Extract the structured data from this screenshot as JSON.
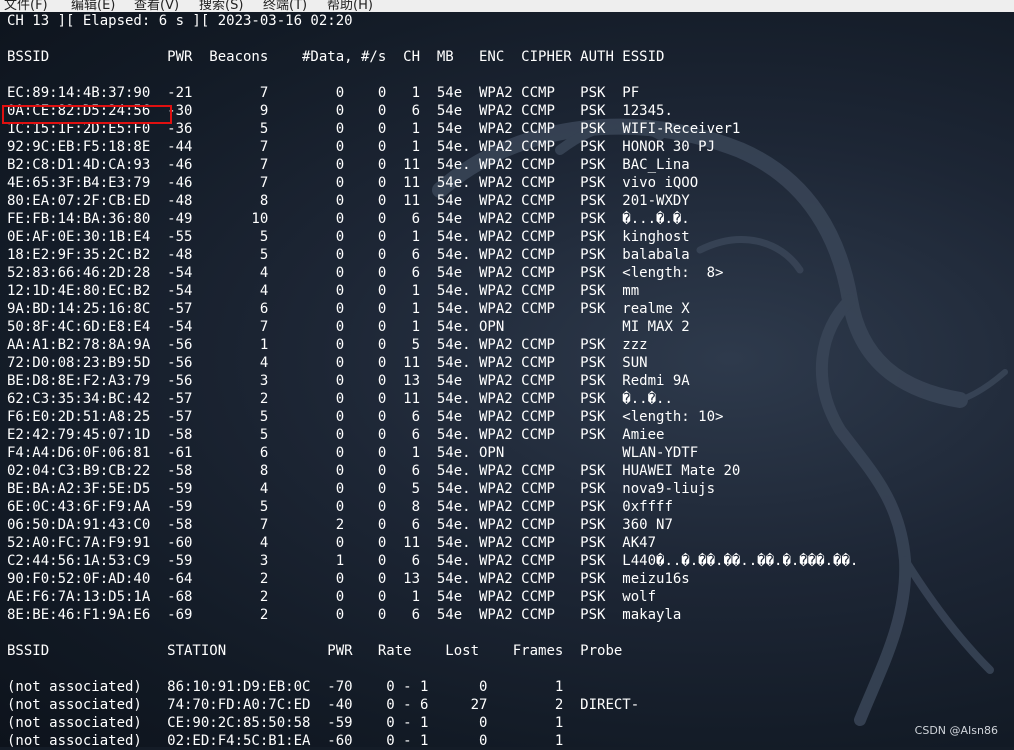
{
  "menu": [
    "文件(F)",
    "编辑(E)",
    "查看(V)",
    "搜索(S)",
    "终端(T)",
    "帮助(H)"
  ],
  "status_line": "CH 13 ][ Elapsed: 6 s ][ 2023-03-16 02:20",
  "ap_header": "BSSID              PWR  Beacons    #Data, #/s  CH  MB   ENC  CIPHER AUTH ESSID",
  "ap_rows": [
    "EC:89:14:4B:37:90  -21        7        0    0   1  54e  WPA2 CCMP   PSK  PF",
    "0A:CE:82:D5:24:56  -30        9        0    0   6  54e  WPA2 CCMP   PSK  12345.",
    "1C:15:1F:2D:E5:F0  -36        5        0    0   1  54e  WPA2 CCMP   PSK  WIFI-Receiver1",
    "92:9C:EB:F5:18:8E  -44        7        0    0   1  54e. WPA2 CCMP   PSK  HONOR 30 PJ",
    "B2:C8:D1:4D:CA:93  -46        7        0    0  11  54e. WPA2 CCMP   PSK  BAC_Lina",
    "4E:65:3F:B4:E3:79  -46        7        0    0  11  54e. WPA2 CCMP   PSK  vivo iQOO",
    "80:EA:07:2F:CB:ED  -48        8        0    0  11  54e  WPA2 CCMP   PSK  201-WXDY",
    "FE:FB:14:BA:36:80  -49       10        0    0   6  54e  WPA2 CCMP   PSK  �...�.�.",
    "0E:AF:0E:30:1B:E4  -55        5        0    0   1  54e. WPA2 CCMP   PSK  kinghost",
    "18:E2:9F:35:2C:B2  -48        5        0    0   6  54e. WPA2 CCMP   PSK  balabala",
    "52:83:66:46:2D:28  -54        4        0    0   6  54e  WPA2 CCMP   PSK  <length:  8>",
    "12:1D:4E:80:EC:B2  -54        4        0    0   1  54e. WPA2 CCMP   PSK  mm",
    "9A:BD:14:25:16:8C  -57        6        0    0   1  54e. WPA2 CCMP   PSK  realme X",
    "50:8F:4C:6D:E8:E4  -54        7        0    0   1  54e. OPN              MI MAX 2",
    "AA:A1:B2:78:8A:9A  -56        1        0    0   5  54e. WPA2 CCMP   PSK  zzz",
    "72:D0:08:23:B9:5D  -56        4        0    0  11  54e. WPA2 CCMP   PSK  SUN",
    "BE:D8:8E:F2:A3:79  -56        3        0    0  13  54e  WPA2 CCMP   PSK  Redmi 9A",
    "62:C3:35:34:BC:42  -57        2        0    0  11  54e. WPA2 CCMP   PSK  �..�..",
    "F6:E0:2D:51:A8:25  -57        5        0    0   6  54e  WPA2 CCMP   PSK  <length: 10>",
    "E2:42:79:45:07:1D  -58        5        0    0   6  54e. WPA2 CCMP   PSK  Amiee",
    "F4:A4:D6:0F:06:81  -61        6        0    0   1  54e. OPN              WLAN-YDTF",
    "02:04:C3:B9:CB:22  -58        8        0    0   6  54e. WPA2 CCMP   PSK  HUAWEI Mate 20",
    "BE:BA:A2:3F:5E:D5  -59        4        0    0   5  54e. WPA2 CCMP   PSK  nova9-liujs",
    "6E:0C:43:6F:F9:AA  -59        5        0    0   8  54e. WPA2 CCMP   PSK  0xffff",
    "06:50:DA:91:43:C0  -58        7        2    0   6  54e. WPA2 CCMP   PSK  360 N7",
    "52:A0:FC:7A:F9:91  -60        4        0    0  11  54e. WPA2 CCMP   PSK  AK47",
    "C2:44:56:1A:53:C9  -59        3        1    0   6  54e. WPA2 CCMP   PSK  L440�..�.��.��..��.�.���.��.",
    "90:F0:52:0F:AD:40  -64        2        0    0  13  54e. WPA2 CCMP   PSK  meizu16s",
    "AE:F6:7A:13:D5:1A  -68        2        0    0   1  54e  WPA2 CCMP   PSK  wolf",
    "8E:BE:46:F1:9A:E6  -69        2        0    0   6  54e  WPA2 CCMP   PSK  makayla"
  ],
  "station_header": "BSSID              STATION            PWR   Rate    Lost    Frames  Probe",
  "station_rows": [
    "(not associated)   86:10:91:D9:EB:0C  -70    0 - 1      0        1",
    "(not associated)   74:70:FD:A0:7C:ED  -40    0 - 6     27        2  DIRECT-",
    "(not associated)   CE:90:2C:85:50:58  -59    0 - 1      0        1",
    "(not associated)   02:ED:F4:5C:B1:EA  -60    0 - 1      0        1"
  ],
  "watermark": "CSDN @AIsn86",
  "colors": {
    "highlight": "#e01010",
    "text": "#ffffff",
    "background": "#141c27"
  }
}
